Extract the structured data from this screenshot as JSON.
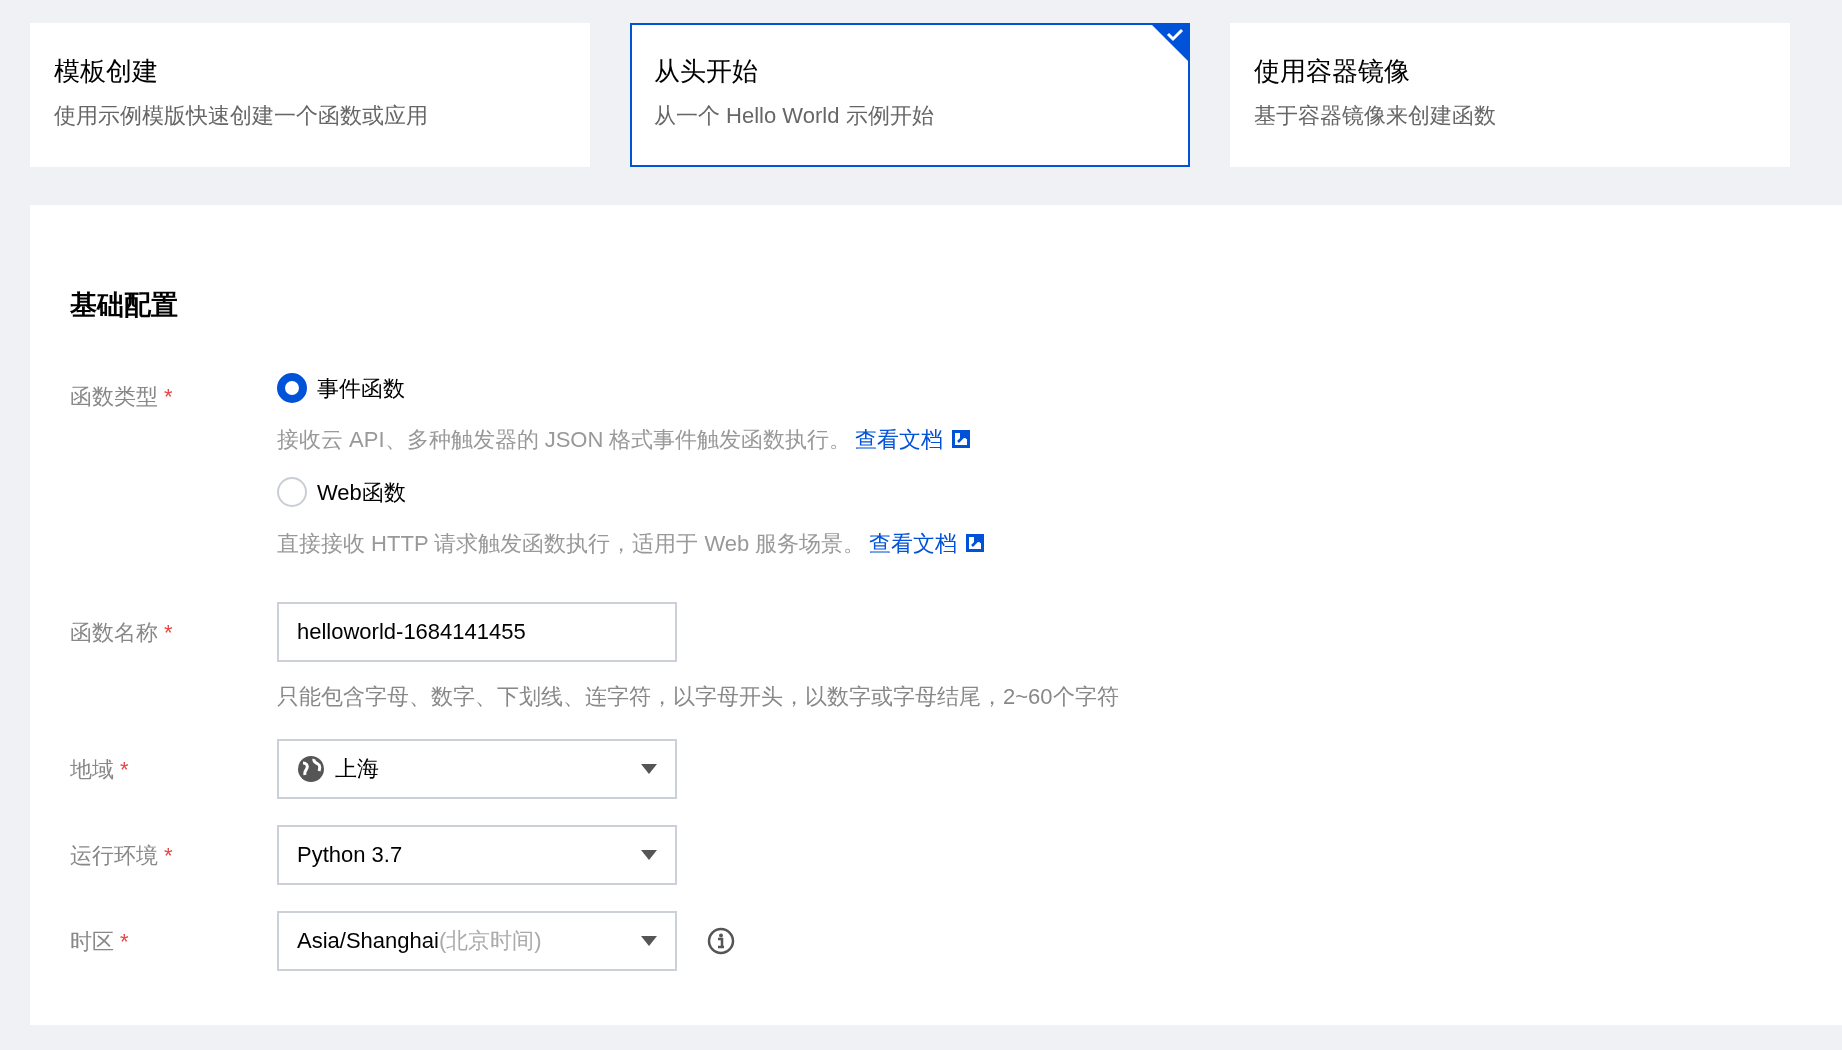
{
  "creation_modes": [
    {
      "title": "模板创建",
      "description": "使用示例模版快速创建一个函数或应用",
      "selected": false
    },
    {
      "title": "从头开始",
      "description": "从一个 Hello World 示例开始",
      "selected": true
    },
    {
      "title": "使用容器镜像",
      "description": "基于容器镜像来创建函数",
      "selected": false
    }
  ],
  "section": {
    "title": "基础配置"
  },
  "fields": [
    {
      "kind": "radio",
      "label": "函数类型",
      "required_mark": "*",
      "options": [
        {
          "label": "事件函数",
          "selected": true,
          "description": "接收云 API、多种触发器的 JSON 格式事件触发函数执行。",
          "link": "查看文档"
        },
        {
          "label": "Web函数",
          "selected": false,
          "description": "直接接收 HTTP 请求触发函数执行，适用于 Web 服务场景。",
          "link": "查看文档"
        }
      ]
    },
    {
      "kind": "text",
      "label": "函数名称",
      "required_mark": "*",
      "value": "helloworld-1684141455",
      "hint": "只能包含字母、数字、下划线、连字符，以字母开头，以数字或字母结尾，2~60个字符"
    },
    {
      "kind": "region-select",
      "label": "地域",
      "required_mark": "*",
      "value": "上海"
    },
    {
      "kind": "select",
      "label": "运行环境",
      "required_mark": "*",
      "value": "Python 3.7"
    },
    {
      "kind": "select",
      "label": "时区",
      "required_mark": "*",
      "value": "Asia/Shanghai",
      "note": "(北京时间)",
      "info": true
    }
  ]
}
